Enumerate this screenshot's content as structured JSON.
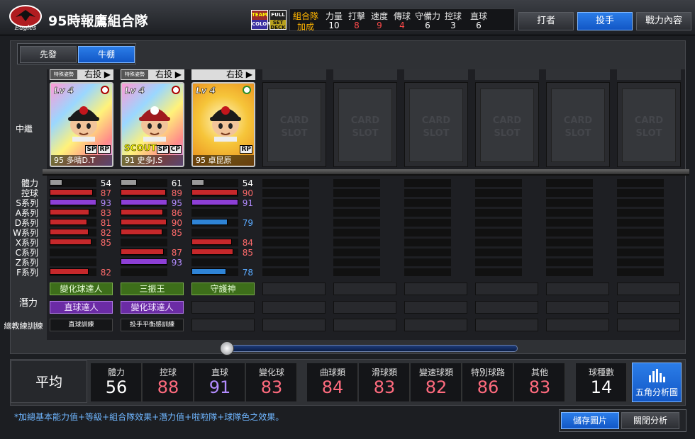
{
  "header": {
    "logo_text": "Eagles",
    "team_name": "95時報鷹組合隊",
    "badges": {
      "team": "TEAM",
      "color": "COLOR",
      "full": "FULL",
      "set": "SET",
      "deck": "DECK"
    },
    "combo_title": "組合隊",
    "combo_subtitle": "加成",
    "combo": [
      {
        "label": "力量",
        "value": "10",
        "color": "#ffffff"
      },
      {
        "label": "打擊",
        "value": "8",
        "color": "#ff4a4a"
      },
      {
        "label": "速度",
        "value": "9",
        "color": "#ff4a4a"
      },
      {
        "label": "傳球",
        "value": "4",
        "color": "#ff4a4a"
      },
      {
        "label": "守備力",
        "value": "6",
        "color": "#ffffff"
      },
      {
        "label": "控球",
        "value": "3",
        "color": "#ffffff"
      },
      {
        "label": "直球",
        "value": "6",
        "color": "#ffffff"
      }
    ],
    "tabs": {
      "batter": "打者",
      "pitcher": "投手",
      "power": "戰力內容"
    }
  },
  "toggles": {
    "starter": "先發",
    "bullpen": "牛棚"
  },
  "row_label": "中繼",
  "slots": [
    {
      "tag": "特殊姿勢",
      "arm": "右投 ▶",
      "level": "Lv 4",
      "name": "95 多晴D.T",
      "tags": [
        "SP",
        "RP"
      ],
      "scout": "",
      "theme": "rainbow",
      "cap": "#1b1b1b",
      "emblem": "#c3161c"
    },
    {
      "tag": "特殊姿勢",
      "arm": "右投 ▶",
      "level": "Lv 4",
      "name": "91 史多J.S",
      "tags": [
        "SP",
        "CP"
      ],
      "scout": "SCOUT",
      "theme": "rainbow",
      "cap": "#a01a1f",
      "emblem": "#ffffff"
    },
    {
      "tag": "",
      "arm": "右投 ▶",
      "level": "Lv 4",
      "name": "95 卓昆原",
      "tags": [
        "RP"
      ],
      "scout": "",
      "theme": "gold",
      "cap": "#1b1b1b",
      "emblem": "#c3161c"
    }
  ],
  "empty_slot_text": [
    "CARD",
    "SLOT"
  ],
  "stat_labels": [
    "體力",
    "控球",
    "S系列",
    "A系列",
    "D系列",
    "W系列",
    "X系列",
    "C系列",
    "Z系列",
    "F系列"
  ],
  "stats": [
    [
      54,
      87,
      93,
      83,
      81,
      82,
      85,
      null,
      null,
      82
    ],
    [
      61,
      89,
      95,
      86,
      90,
      85,
      null,
      87,
      93,
      null
    ],
    [
      54,
      90,
      91,
      null,
      79,
      null,
      84,
      85,
      null,
      78
    ]
  ],
  "stat_colors": {
    "stamina": "#9a9a9a",
    "red": "#c6282b",
    "purple": "#8d3fd6",
    "blue": "#2f84d6"
  },
  "stat_types": [
    [
      "stamina",
      "red",
      "purple",
      "red",
      "red",
      "red",
      "red",
      null,
      null,
      "red"
    ],
    [
      "stamina",
      "red",
      "purple",
      "red",
      "red",
      "red",
      null,
      "red",
      "purple",
      null
    ],
    [
      "stamina",
      "red",
      "purple",
      null,
      "blue",
      null,
      "red",
      "red",
      null,
      "blue"
    ]
  ],
  "potential_label": "潛力",
  "coach_label": "總教練訓練",
  "potentials": [
    {
      "p1": "變化球達人",
      "p2": "直球達人",
      "coach": "直球訓練"
    },
    {
      "p1": "三振王",
      "p2": "變化球達人",
      "coach": "投手平衡感訓練"
    },
    {
      "p1": "守護神",
      "p2": "",
      "coach": ""
    }
  ],
  "average": {
    "label": "平均",
    "cells": [
      {
        "label": "體力",
        "value": "56",
        "color": "#ffffff"
      },
      {
        "label": "控球",
        "value": "88",
        "color": "#ff6b7e"
      },
      {
        "label": "直球",
        "value": "91",
        "color": "#b38cff"
      },
      {
        "label": "變化球",
        "value": "83",
        "color": "#ff6b7e"
      },
      {
        "label": "曲球類",
        "value": "84",
        "color": "#ff6b7e"
      },
      {
        "label": "滑球類",
        "value": "83",
        "color": "#ff6b7e"
      },
      {
        "label": "變速球類",
        "value": "82",
        "color": "#ff6b7e"
      },
      {
        "label": "特別球路",
        "value": "86",
        "color": "#ff6b7e"
      },
      {
        "label": "其他",
        "value": "83",
        "color": "#ff6b7e"
      },
      {
        "label": "球種數",
        "value": "14",
        "color": "#ffffff"
      }
    ],
    "pentagon_button": "五角分析圖"
  },
  "footnote": "*加總基本能力值+等級+組合隊效果+潛力值+啦啦隊+球隊色之效果。",
  "buttons": {
    "save_image": "儲存圖片",
    "close_analysis": "關閉分析"
  }
}
